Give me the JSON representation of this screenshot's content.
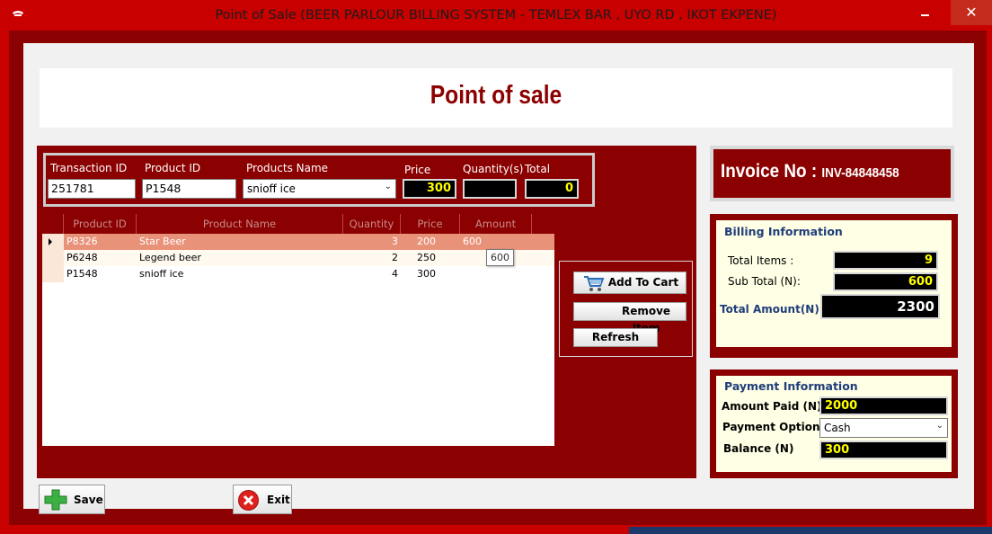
{
  "window": {
    "title": "Point of Sale (BEER PARLOUR BILLING SYSTEM - TEMLEX BAR , UYO RD , IKOT EKPENE)",
    "min_glyph": "",
    "max_glyph": "",
    "close_glyph": "✕"
  },
  "header": {
    "title": "Point of sale"
  },
  "fields": {
    "transaction_id_label": "Transaction ID",
    "transaction_id_value": "251781",
    "product_id_label": "Product ID",
    "product_id_value": "P1548",
    "products_name_label": "Products Name",
    "products_name_value": "snioff ice",
    "price_label": "Price",
    "price_value": "300",
    "quantity_label": "Quantity(s)",
    "quantity_value": "",
    "total_label": "Total",
    "total_value": "0"
  },
  "grid": {
    "columns": [
      "Product ID",
      "Product Name",
      "Quantity",
      "Price",
      "Amount"
    ],
    "rows": [
      {
        "product_id": "P8326",
        "product_name": "Star Beer",
        "quantity": "3",
        "price": "200",
        "amount": "600"
      },
      {
        "product_id": "P6248",
        "product_name": "Legend beer",
        "quantity": "2",
        "price": "250",
        "amount": ""
      },
      {
        "product_id": "P1548",
        "product_name": "snioff ice",
        "quantity": "4",
        "price": "300",
        "amount": ""
      }
    ],
    "tooltip": "600"
  },
  "actions": {
    "add_to_cart": "Add To Cart",
    "remove_item": "Remove Item",
    "refresh": "Refresh"
  },
  "invoice": {
    "label": "Invoice No : ",
    "number": "INV-84848458"
  },
  "billing": {
    "heading": "Billing Information",
    "total_items_label": "Total Items :",
    "total_items_value": "9",
    "sub_total_label": "Sub Total (N):",
    "sub_total_value": "600",
    "total_amount_label": "Total Amount(N) :",
    "total_amount_value": "2300"
  },
  "payment": {
    "heading": "Payment Information",
    "amount_paid_label": "Amount Paid (N)",
    "amount_paid_value": "2000",
    "payment_option_label": "Payment Option",
    "payment_option_value": "Cash",
    "balance_label": "Balance (N)",
    "balance_value": "300"
  },
  "buttons": {
    "save": "Save",
    "exit": "Exit"
  },
  "colors": {
    "frame": "#c80000",
    "panel": "#8b0000",
    "highlight_row": "#e8927a",
    "info_bg": "#ffffe5",
    "value_text": "#ffff00"
  },
  "icons": {
    "app": "beer-mug-icon",
    "cart": "cart-icon",
    "save": "plus-icon",
    "exit": "close-circle-icon",
    "dropdown": "chevron-down-icon",
    "row_pointer": "row-pointer-icon"
  }
}
